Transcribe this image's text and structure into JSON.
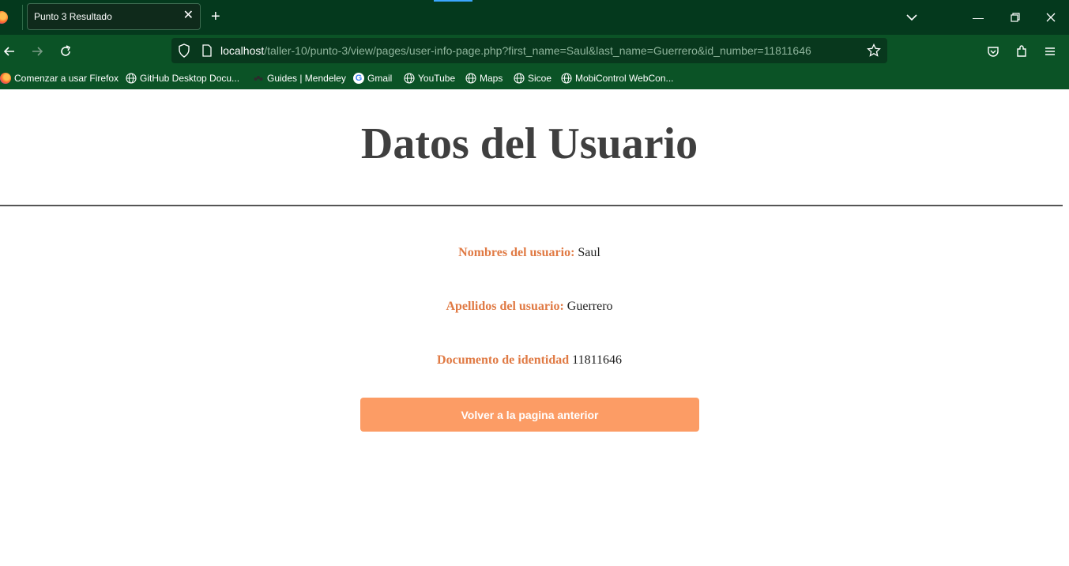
{
  "browser": {
    "tab_title": "Punto 3 Resultado",
    "url_host": "localhost",
    "url_path": "/taller-10/punto-3/view/pages/user-info-page.php?first_name=Saul&last_name=Guerrero&id_number=11811646",
    "bookmarks": [
      {
        "label": "Comenzar a usar Firefox",
        "icon": "firefox-icon"
      },
      {
        "label": "GitHub Desktop Docu...",
        "icon": "globe-icon"
      },
      {
        "label": "Guides | Mendeley",
        "icon": "mendeley-icon"
      },
      {
        "label": "Gmail",
        "icon": "google-icon"
      },
      {
        "label": "YouTube",
        "icon": "globe-icon"
      },
      {
        "label": "Maps",
        "icon": "globe-icon"
      },
      {
        "label": "Sicoe",
        "icon": "globe-icon"
      },
      {
        "label": "MobiControl WebCon...",
        "icon": "globe-icon"
      }
    ]
  },
  "page": {
    "title": "Datos del Usuario",
    "fields": [
      {
        "label": "Nombres del usuario:",
        "value": "Saul"
      },
      {
        "label": "Apellidos del usuario:",
        "value": "Guerrero"
      },
      {
        "label": "Documento de identidad",
        "value": "11811646"
      }
    ],
    "back_button": "Volver a la pagina anterior"
  },
  "colors": {
    "title_bar": "#04391d",
    "toolbar": "#0b5326",
    "label_accent": "#e07a44",
    "button": "#fc9c65",
    "title_text": "#3f3f3f"
  }
}
